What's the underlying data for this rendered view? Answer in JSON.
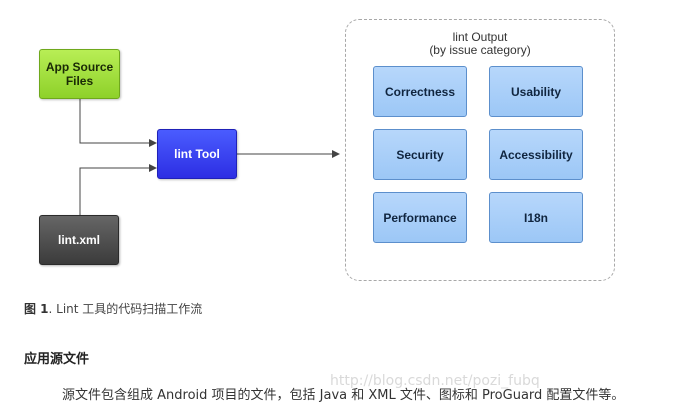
{
  "diagram": {
    "source_box": "App Source\nFiles",
    "tool_box": "lint Tool",
    "config_box": "lint.xml",
    "output_title_line1": "lint Output",
    "output_title_line2": "(by issue category)",
    "categories": [
      "Correctness",
      "Usability",
      "Security",
      "Accessibility",
      "Performance",
      "I18n"
    ]
  },
  "caption": {
    "label": "图 1",
    "text": ". Lint 工具的代码扫描工作流"
  },
  "section": {
    "heading": "应用源文件",
    "paragraph": "源文件包含组成 Android 项目的文件，包括 Java 和 XML 文件、图标和 ProGuard 配置文件等。"
  },
  "watermark": "http://blog.csdn.net/pozi_fubq",
  "colors": {
    "source": "#9edc3a",
    "tool": "#3a40f2",
    "config": "#4a4a4a",
    "category": "#a9cff8",
    "connector": "#444444"
  }
}
